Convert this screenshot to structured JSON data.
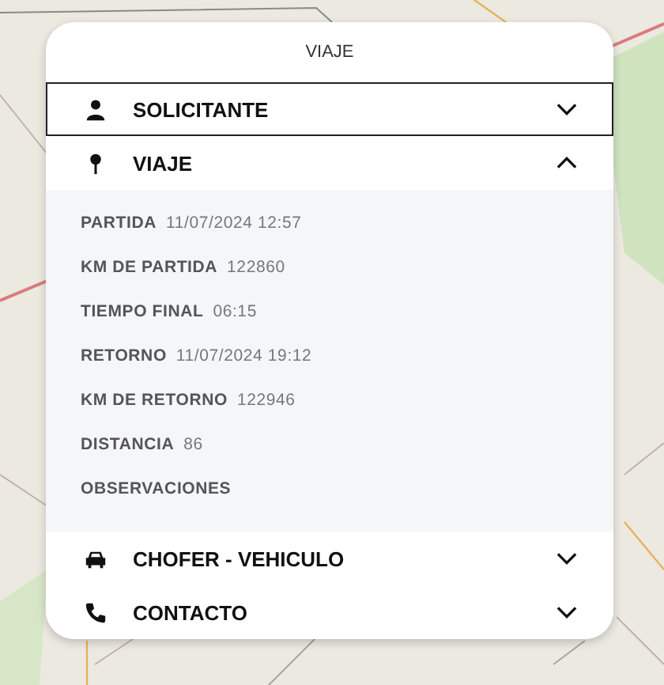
{
  "title": "VIAJE",
  "sections": [
    {
      "kind": "person",
      "label": "SOLICITANTE",
      "focused": true,
      "expanded": false
    },
    {
      "kind": "pin",
      "label": "VIAJE",
      "focused": false,
      "expanded": true,
      "fields": [
        {
          "label": "PARTIDA",
          "value": "11/07/2024 12:57"
        },
        {
          "label": "KM DE PARTIDA",
          "value": "122860"
        },
        {
          "label": "TIEMPO FINAL",
          "value": "06:15"
        },
        {
          "label": "RETORNO",
          "value": "11/07/2024 19:12"
        },
        {
          "label": "KM DE RETORNO",
          "value": "122946"
        },
        {
          "label": "DISTANCIA",
          "value": "86"
        },
        {
          "label": "OBSERVACIONES"
        }
      ]
    },
    {
      "kind": "car",
      "label": "CHOFER - VEHICULO",
      "focused": false,
      "expanded": false
    },
    {
      "kind": "phone",
      "label": "CONTACTO",
      "focused": false,
      "expanded": false
    }
  ]
}
